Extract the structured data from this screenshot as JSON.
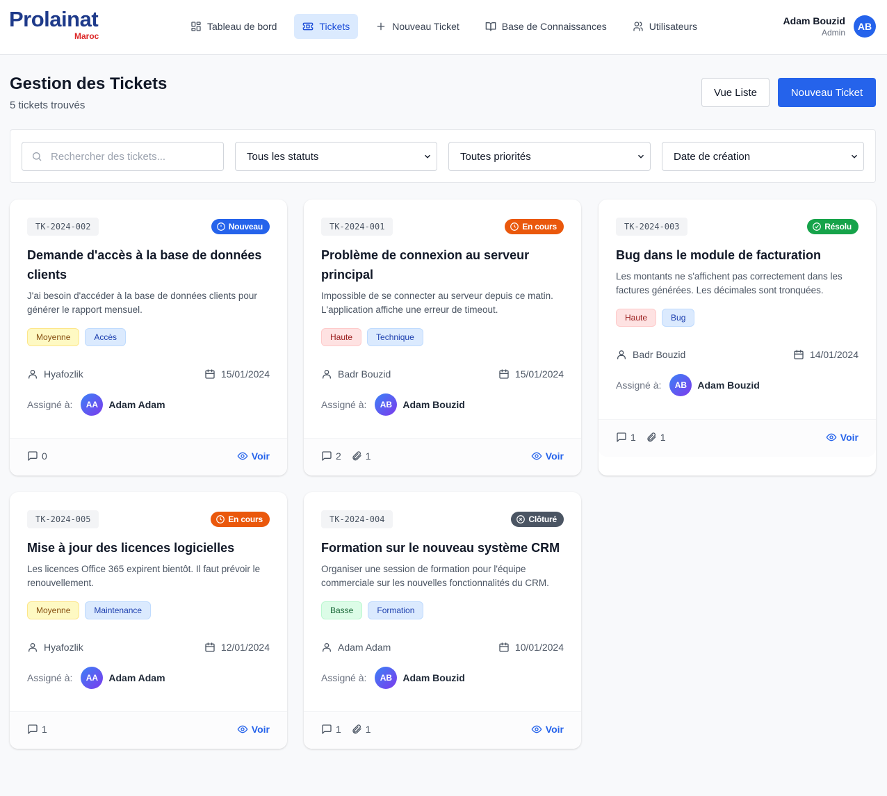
{
  "brand": {
    "name": "Prolainat",
    "sub": "Maroc"
  },
  "nav": {
    "dashboard": "Tableau de bord",
    "tickets": "Tickets",
    "new_ticket": "Nouveau Ticket",
    "knowledge": "Base de Connaissances",
    "users": "Utilisateurs"
  },
  "user": {
    "name": "Adam Bouzid",
    "role": "Admin",
    "initials": "AB"
  },
  "page": {
    "title": "Gestion des Tickets",
    "count": "5 tickets trouvés",
    "list_view_label": "Vue Liste",
    "new_ticket_label": "Nouveau Ticket"
  },
  "filters": {
    "search_placeholder": "Rechercher des tickets...",
    "status": "Tous les statuts",
    "priority": "Toutes priorités",
    "sort": "Date de création"
  },
  "labels": {
    "assigned": "Assigné à:",
    "view": "Voir"
  },
  "tickets": [
    {
      "id": "TK-2024-002",
      "status": "Nouveau",
      "title": "Demande d'accès à la base de données clients",
      "description": "J'ai besoin d'accéder à la base de données clients pour générer le rapport mensuel.",
      "priority": "Moyenne",
      "category": "Accès",
      "author": "Hyafozlik",
      "date": "15/01/2024",
      "assignee_initials": "AA",
      "assignee": "Adam Adam",
      "comments": "0",
      "attachments": ""
    },
    {
      "id": "TK-2024-001",
      "status": "En cours",
      "title": "Problème de connexion au serveur principal",
      "description": "Impossible de se connecter au serveur depuis ce matin. L'application affiche une erreur de timeout.",
      "priority": "Haute",
      "category": "Technique",
      "author": "Badr Bouzid",
      "date": "15/01/2024",
      "assignee_initials": "AB",
      "assignee": "Adam Bouzid",
      "comments": "2",
      "attachments": "1"
    },
    {
      "id": "TK-2024-003",
      "status": "Résolu",
      "title": "Bug dans le module de facturation",
      "description": "Les montants ne s'affichent pas correctement dans les factures générées. Les décimales sont tronquées.",
      "priority": "Haute",
      "category": "Bug",
      "author": "Badr Bouzid",
      "date": "14/01/2024",
      "assignee_initials": "AB",
      "assignee": "Adam Bouzid",
      "comments": "1",
      "attachments": "1"
    },
    {
      "id": "TK-2024-005",
      "status": "En cours",
      "title": "Mise à jour des licences logicielles",
      "description": "Les licences Office 365 expirent bientôt. Il faut prévoir le renouvellement.",
      "priority": "Moyenne",
      "category": "Maintenance",
      "author": "Hyafozlik",
      "date": "12/01/2024",
      "assignee_initials": "AA",
      "assignee": "Adam Adam",
      "comments": "1",
      "attachments": ""
    },
    {
      "id": "TK-2024-004",
      "status": "Clôturé",
      "title": "Formation sur le nouveau système CRM",
      "description": "Organiser une session de formation pour l'équipe commerciale sur les nouvelles fonctionnalités du CRM.",
      "priority": "Basse",
      "category": "Formation",
      "author": "Adam Adam",
      "date": "10/01/2024",
      "assignee_initials": "AB",
      "assignee": "Adam Bouzid",
      "comments": "1",
      "attachments": "1"
    }
  ]
}
